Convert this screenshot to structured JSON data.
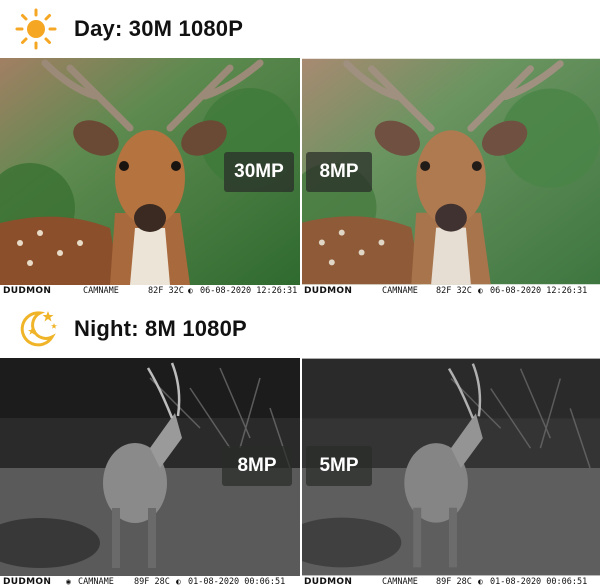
{
  "day": {
    "icon": "sun-icon",
    "title": "Day: 30M 1080P",
    "panels": [
      {
        "badge": "30MP",
        "brand": "DUDMON",
        "camname": "CAMNAME",
        "temp": "82F  32C",
        "moon": "moon-phase-icon",
        "datetime": "06-08-2020  12:26:31"
      },
      {
        "badge": "8MP",
        "brand": "DUDMON",
        "camname": "CAMNAME",
        "temp": "82F  32C",
        "moon": "moon-phase-icon",
        "datetime": "06-08-2020  12:26:31"
      }
    ]
  },
  "night": {
    "icon": "moon-stars-icon",
    "title": "Night: 8M 1080P",
    "panels": [
      {
        "badge": "8MP",
        "brand": "DUDMON",
        "camname": "CAMNAME",
        "temp": "89F  28C",
        "moon": "moon-phase-icon",
        "datetime": "01-08-2020  00:06:51"
      },
      {
        "badge": "5MP",
        "brand": "DUDMON",
        "camname": "CAMNAME",
        "temp": "89F  28C",
        "moon": "moon-phase-icon",
        "datetime": "01-08-2020  00:06:51"
      }
    ]
  },
  "colors": {
    "sun": "#f5a623",
    "moon": "#f0b429",
    "badge_bg": "#2b302b"
  }
}
